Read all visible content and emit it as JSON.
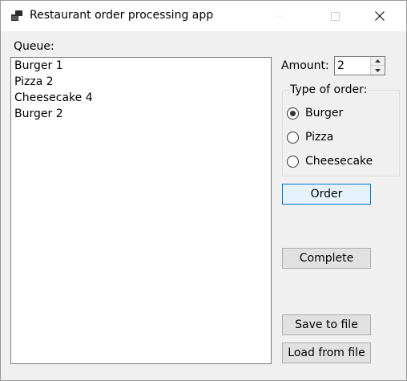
{
  "window": {
    "title": "Restaurant order processing app",
    "icon": "app-window-icon"
  },
  "queue": {
    "label": "Queue:",
    "items": [
      "Burger 1",
      "Pizza 2",
      "Cheesecake 4",
      "Burger 2"
    ]
  },
  "amount": {
    "label": "Amount:",
    "value": "2"
  },
  "order_type": {
    "legend": "Type of order:",
    "options": [
      {
        "label": "Burger",
        "checked": true
      },
      {
        "label": "Pizza",
        "checked": false
      },
      {
        "label": "Cheesecake",
        "checked": false
      }
    ]
  },
  "buttons": {
    "order": "Order",
    "complete": "Complete",
    "save": "Save to file",
    "load": "Load from file"
  }
}
